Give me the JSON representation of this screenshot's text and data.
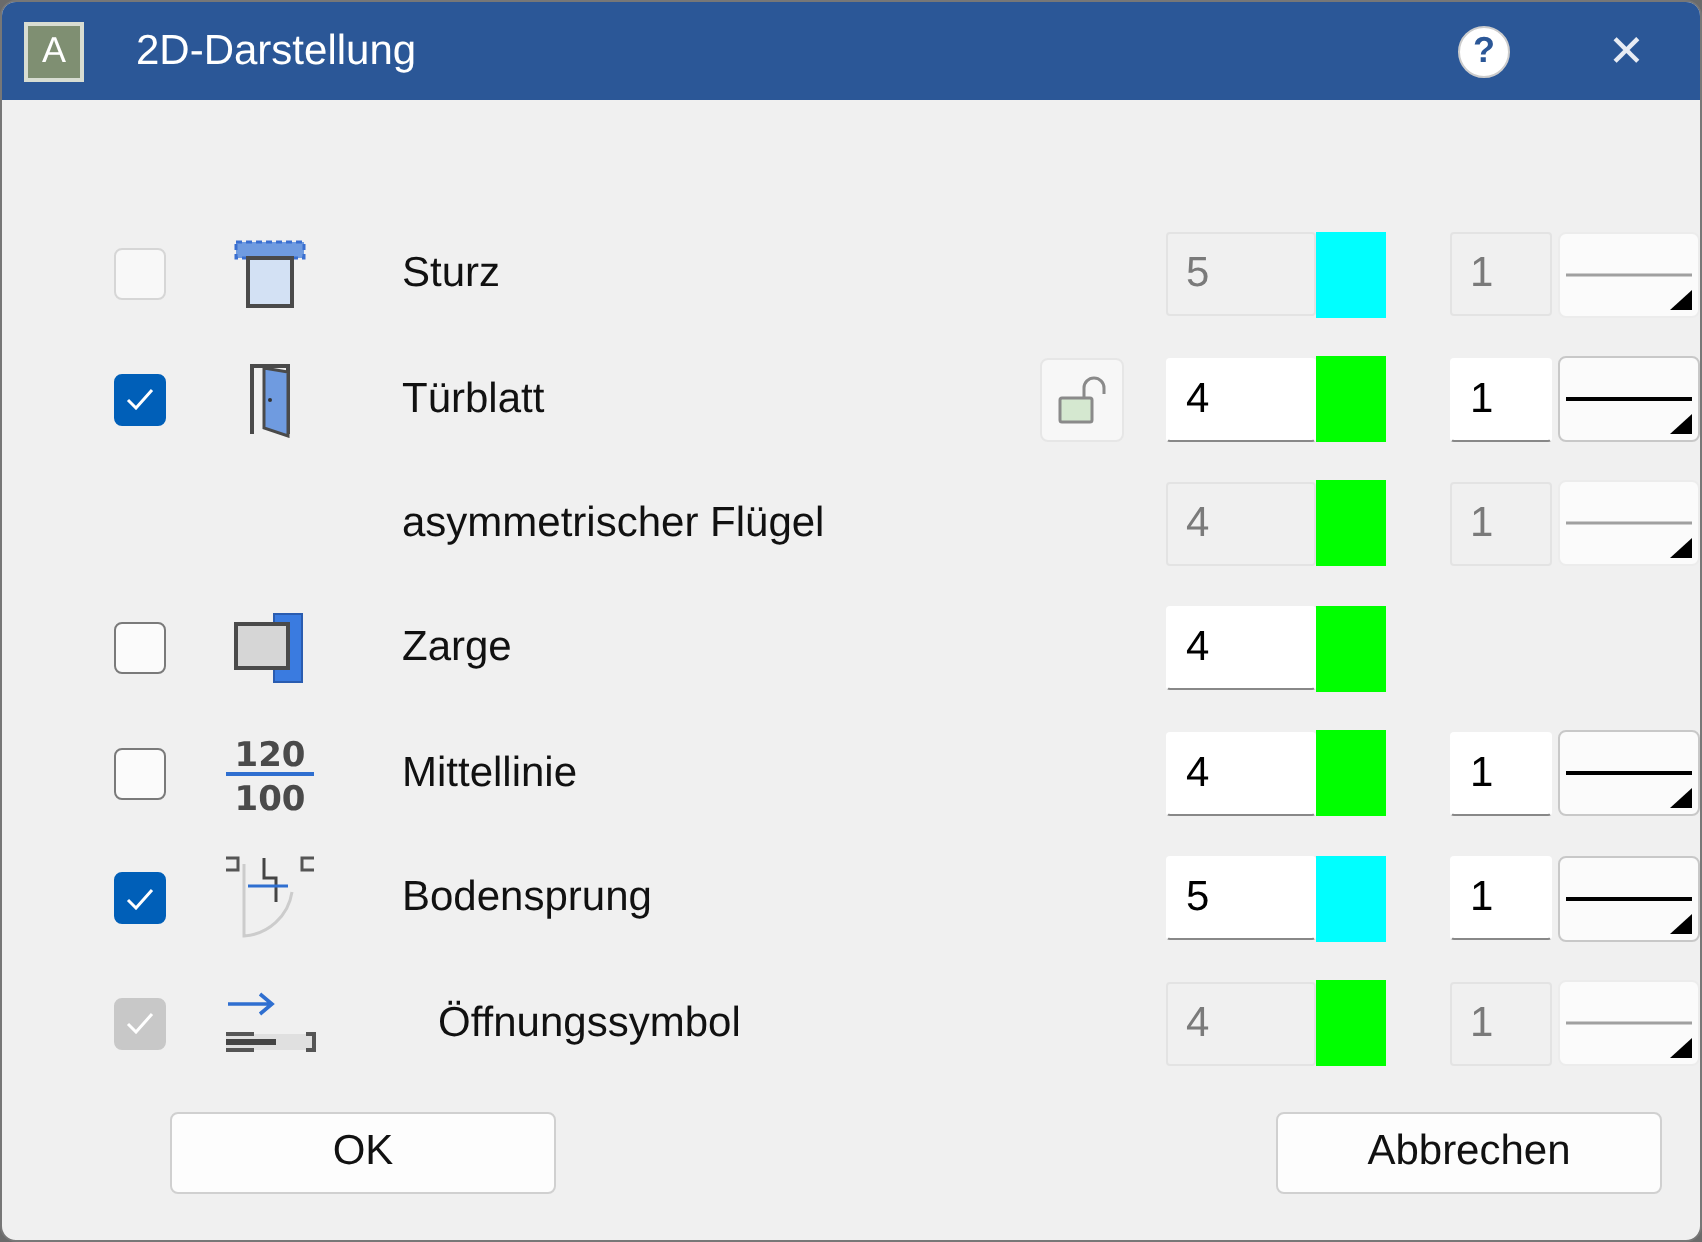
{
  "window": {
    "title": "2D-Darstellung",
    "app_icon_letter": "A",
    "help": "?",
    "close": "✕"
  },
  "rows": [
    {
      "label": "Sturz",
      "kind": "sturz",
      "checkbox": {
        "checked": false,
        "disabled": true
      },
      "disabled": true,
      "pen": "5",
      "color": "#00ffff",
      "weight": "1"
    },
    {
      "label": "Türblatt",
      "kind": "door",
      "checkbox": {
        "checked": true,
        "disabled": false
      },
      "disabled": false,
      "lock": {
        "locked": false
      },
      "pen": "4",
      "color": "#00ff00",
      "weight": "1"
    },
    {
      "label": "asymmetrischer Flügel",
      "disabled": true,
      "pen": "4",
      "color": "#00ff00",
      "weight": "1"
    },
    {
      "label": "Zarge",
      "kind": "frame",
      "checkbox": {
        "checked": false,
        "disabled": false
      },
      "disabled": false,
      "pen": "4",
      "color": "#00ff00"
    },
    {
      "label": "Mittellinie",
      "kind": "fraction",
      "icon_text": [
        "120",
        "100"
      ],
      "checkbox": {
        "checked": false,
        "disabled": false
      },
      "disabled": false,
      "pen": "4",
      "color": "#00ff00",
      "weight": "1"
    },
    {
      "label": "Bodensprung",
      "kind": "floor",
      "checkbox": {
        "checked": true,
        "disabled": false
      },
      "disabled": false,
      "pen": "5",
      "color": "#00ffff",
      "weight": "1"
    },
    {
      "label": "Öffnungssymbol",
      "indent": true,
      "kind": "opening",
      "checkbox": {
        "checked": true,
        "disabled": true
      },
      "disabled": true,
      "pen": "4",
      "color": "#00ff00",
      "weight": "1"
    }
  ],
  "buttons": [
    "OK",
    "Abbrechen"
  ]
}
